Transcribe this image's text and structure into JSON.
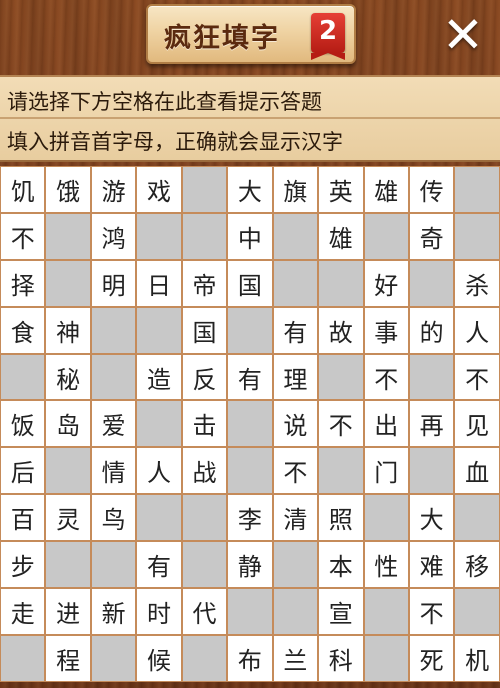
{
  "header": {
    "title": "疯狂填字",
    "badge": "2",
    "close_label": "✕"
  },
  "hint": {
    "line1": "请选择下方空格在此查看提示答题",
    "line2": "填入拼音首字母，正确就会显示汉字"
  },
  "colors": {
    "wood": "#7a3d1b",
    "cell_letter": "#ffffff",
    "cell_blank": "#c8c8c8",
    "grid_border": "#c58b5a",
    "badge_red": "#d12b20"
  },
  "grid": {
    "rows": [
      [
        "饥",
        "饿",
        "游",
        "戏",
        "",
        "大",
        "旗",
        "英",
        "雄",
        "传",
        ""
      ],
      [
        "不",
        "",
        "鸿",
        "",
        "",
        "中",
        "",
        "雄",
        "",
        "奇",
        ""
      ],
      [
        "择",
        "",
        "明",
        "日",
        "帝",
        "国",
        "",
        "",
        "好",
        "",
        "杀"
      ],
      [
        "食",
        "神",
        "",
        "",
        "国",
        "",
        "有",
        "故",
        "事",
        "的",
        "人"
      ],
      [
        "",
        "秘",
        "",
        "造",
        "反",
        "有",
        "理",
        "",
        "不",
        "",
        "不"
      ],
      [
        "饭",
        "岛",
        "爱",
        "",
        "击",
        "",
        "说",
        "不",
        "出",
        "再",
        "见"
      ],
      [
        "后",
        "",
        "情",
        "人",
        "战",
        "",
        "不",
        "",
        "门",
        "",
        "血"
      ],
      [
        "百",
        "灵",
        "鸟",
        "",
        "",
        "李",
        "清",
        "照",
        "",
        "大",
        ""
      ],
      [
        "步",
        "",
        "",
        "有",
        "",
        "静",
        "",
        "本",
        "性",
        "难",
        "移"
      ],
      [
        "走",
        "进",
        "新",
        "时",
        "代",
        "",
        "",
        "宣",
        "",
        "不",
        ""
      ],
      [
        "",
        "程",
        "",
        "候",
        "",
        "布",
        "兰",
        "科",
        "",
        "死",
        "机"
      ]
    ]
  }
}
